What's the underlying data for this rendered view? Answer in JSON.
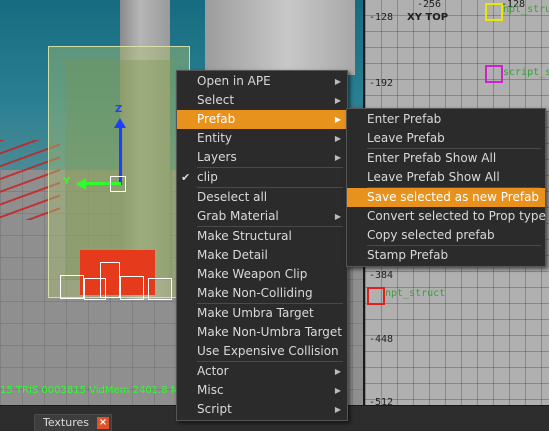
{
  "status_bar": {
    "text": "15  TRIS 0003815  VidMem 2401.8 M"
  },
  "viewport2d": {
    "view_label": "XY TOP",
    "top_labels": [
      "-256",
      "-128"
    ],
    "left_labels": [
      "-128",
      "-192",
      "-384",
      "-448",
      "-512"
    ],
    "entities": [
      "npt_struct",
      "script_struct",
      "npt_struct"
    ]
  },
  "gizmo": {
    "z_label": "Z",
    "y_label": "Y"
  },
  "bottom": {
    "textures_tab": "Textures",
    "close_glyph": "×"
  },
  "menu": {
    "items": [
      {
        "label": "Open in APE",
        "arrow": "▶"
      },
      {
        "label": "Select",
        "arrow": "▶"
      },
      {
        "label": "Prefab",
        "arrow": "▶"
      },
      {
        "label": "Entity",
        "arrow": "▶"
      },
      {
        "label": "Layers",
        "arrow": "▶"
      },
      {
        "label": "clip",
        "check": "✔"
      },
      {
        "label": "Deselect all"
      },
      {
        "label": "Grab Material",
        "arrow": "▶"
      },
      {
        "label": "Make Structural"
      },
      {
        "label": "Make Detail"
      },
      {
        "label": "Make Weapon Clip"
      },
      {
        "label": "Make Non-Colliding"
      },
      {
        "label": "Make Umbra Target"
      },
      {
        "label": "Make Non-Umbra Target"
      },
      {
        "label": "Use Expensive Collision"
      },
      {
        "label": "Actor",
        "arrow": "▶"
      },
      {
        "label": "Misc",
        "arrow": "▶"
      },
      {
        "label": "Script",
        "arrow": "▶"
      }
    ]
  },
  "prefab_submenu": {
    "items": [
      {
        "label": "Enter Prefab"
      },
      {
        "label": "Leave Prefab"
      },
      {
        "label": "Enter Prefab Show All"
      },
      {
        "label": "Leave Prefab Show All"
      },
      {
        "label": "Save selected as new Prefab"
      },
      {
        "label": "Convert selected to Prop type"
      },
      {
        "label": "Copy selected prefab"
      },
      {
        "label": "Stamp Prefab"
      }
    ]
  },
  "colors": {
    "highlight": "#e8921e",
    "menu_bg": "#2b2b2b",
    "status_text": "#2dff2d"
  }
}
